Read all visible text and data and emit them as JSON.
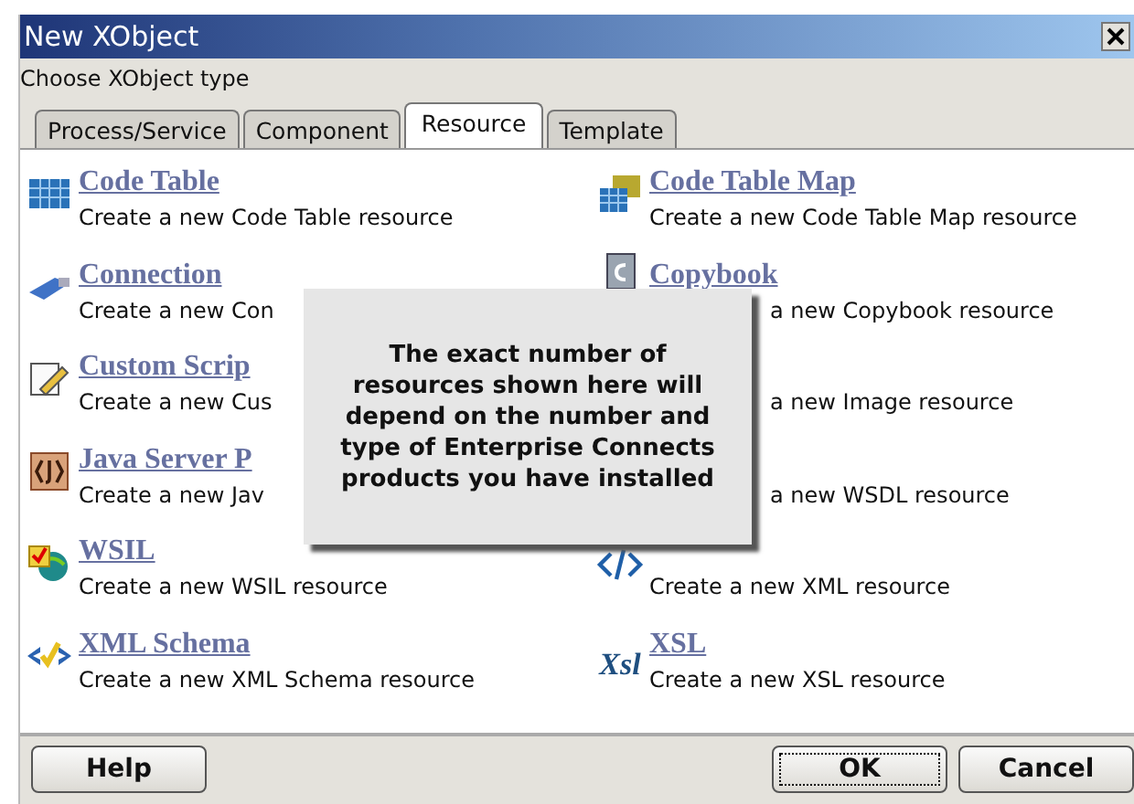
{
  "window": {
    "title": "New XObject"
  },
  "prompt": "Choose XObject type",
  "tabs": [
    {
      "label": "Process/Service",
      "selected": false
    },
    {
      "label": "Component",
      "selected": false
    },
    {
      "label": "Resource",
      "selected": true
    },
    {
      "label": "Template",
      "selected": false
    }
  ],
  "left_items": [
    {
      "title": "Code Table",
      "description": "Create a new Code Table resource"
    },
    {
      "title": "Connection",
      "description": "Create a new Con"
    },
    {
      "title": "Custom Scrip",
      "description": "Create a new Cus"
    },
    {
      "title": "Java Server P",
      "description": "Create a new Jav"
    },
    {
      "title": "WSIL",
      "description": "Create a new WSIL resource"
    },
    {
      "title": "XML Schema",
      "description": "Create a new XML Schema resource"
    }
  ],
  "right_items": [
    {
      "title": "Code Table Map",
      "description": "Create a new Code Table Map resource",
      "covered": false
    },
    {
      "title": "Copybook",
      "description": "a new Copybook resource",
      "covered": true
    },
    {
      "description": "a new Image resource",
      "covered": true
    },
    {
      "description": "a new WSDL resource",
      "covered": true
    },
    {
      "description": "Create a new XML resource"
    },
    {
      "icon_text": "Xsl",
      "title": "XSL",
      "description": "Create a new XSL resource"
    }
  ],
  "callout": "The exact number of resources shown here will depend on the number and type of Enterprise Connects products you have installed",
  "buttons": {
    "help": "Help",
    "ok": "OK",
    "cancel": "Cancel"
  }
}
